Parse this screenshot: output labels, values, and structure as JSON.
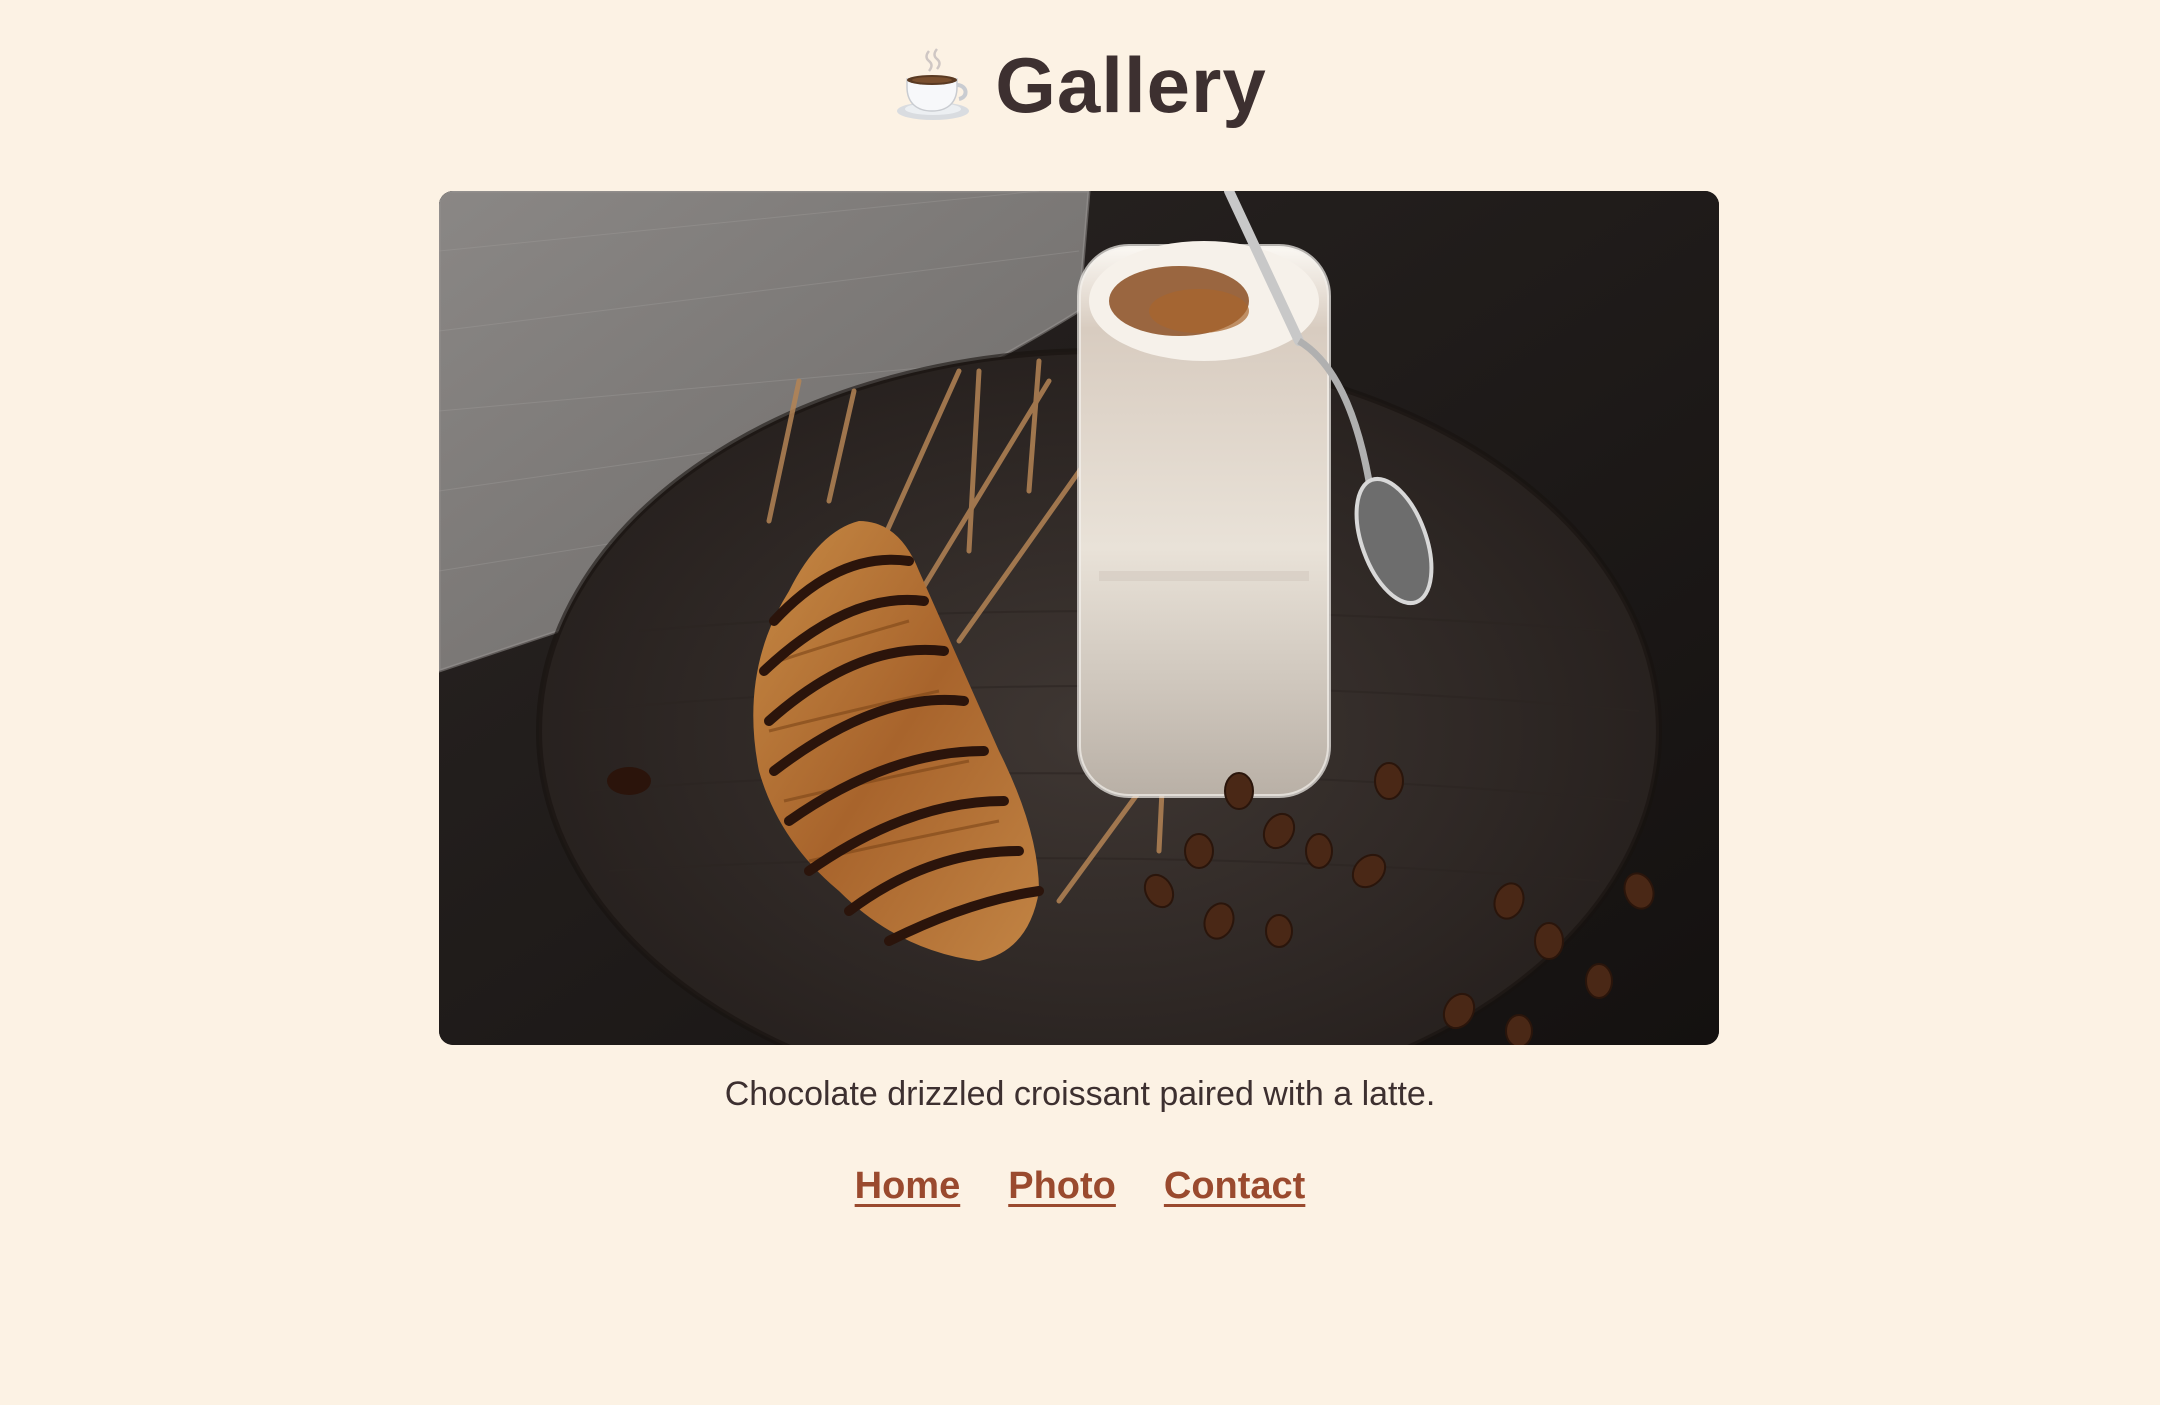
{
  "header": {
    "icon": "coffee-cup-icon",
    "title": "Gallery"
  },
  "photo": {
    "alt": "",
    "caption": "Chocolate drizzled croissant paired with a latte."
  },
  "nav": {
    "links": [
      "Home",
      "Photo",
      "Contact"
    ]
  },
  "colors": {
    "background": "#fcf2e4",
    "text": "#3d3030",
    "link": "#9a4a2e"
  }
}
